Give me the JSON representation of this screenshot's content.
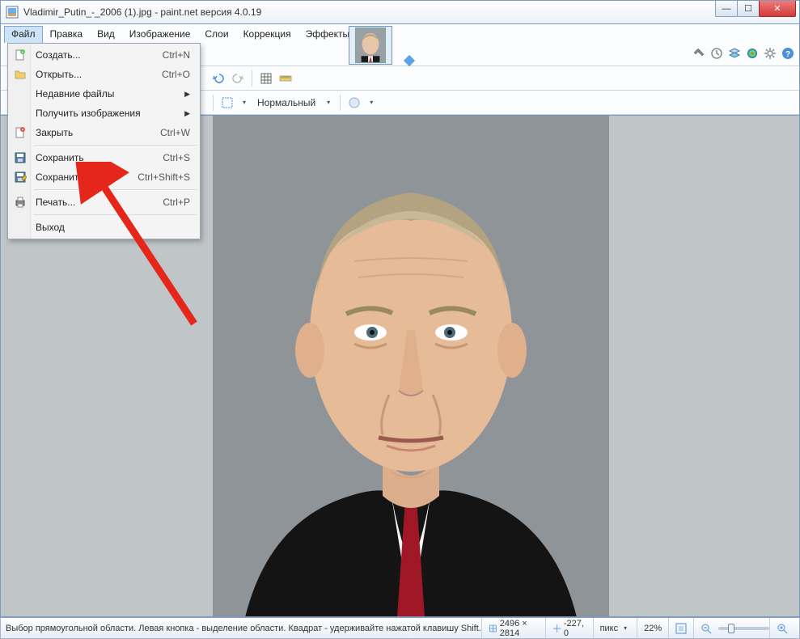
{
  "window": {
    "title": "Vladimir_Putin_-_2006 (1).jpg - paint.net версия 4.0.19"
  },
  "menus": {
    "items": [
      "Файл",
      "Правка",
      "Вид",
      "Изображение",
      "Слои",
      "Коррекция",
      "Эффекты"
    ],
    "open_index": 0
  },
  "file_menu": {
    "create": {
      "label": "Создать...",
      "shortcut": "Ctrl+N"
    },
    "open": {
      "label": "Открыть...",
      "shortcut": "Ctrl+O"
    },
    "recent": {
      "label": "Недавние файлы"
    },
    "acquire": {
      "label": "Получить изображения"
    },
    "close": {
      "label": "Закрыть",
      "shortcut": "Ctrl+W"
    },
    "save": {
      "label": "Сохранить",
      "shortcut": "Ctrl+S"
    },
    "saveas": {
      "label": "Сохранить как...",
      "shortcut": "Ctrl+Shift+S"
    },
    "print": {
      "label": "Печать...",
      "shortcut": "Ctrl+P"
    },
    "exit": {
      "label": "Выход"
    }
  },
  "toolbar": {
    "blend_label": "Нормальный"
  },
  "statusbar": {
    "hint": "Выбор прямоугольной области. Левая кнопка - выделение области. Квадрат - удерживайте нажатой клавишу Shift.",
    "dimensions": "2496 × 2814",
    "cursor": "-227, 0",
    "units": "пикс",
    "zoom": "22%"
  }
}
